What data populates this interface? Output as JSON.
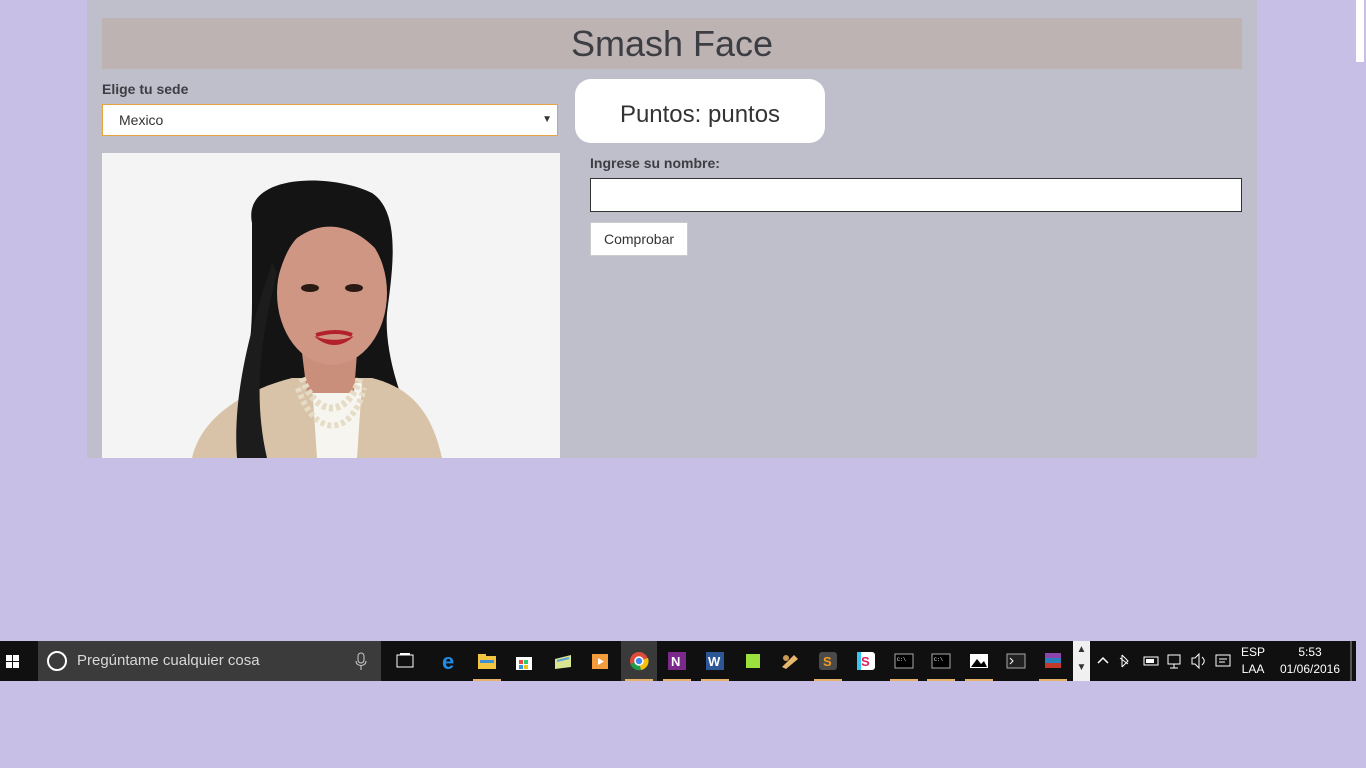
{
  "header": {
    "title": "Smash Face"
  },
  "form": {
    "sede_label": "Elige tu sede",
    "sede_selected": "Mexico",
    "score_text": "Puntos: puntos",
    "name_label": "Ingrese su nombre:",
    "name_value": "",
    "submit_label": "Comprobar"
  },
  "taskbar": {
    "search_placeholder": "Pregúntame cualquier cosa",
    "apps": [
      "task-view",
      "edge",
      "file-explorer",
      "store",
      "folder-sync",
      "media-player",
      "chrome",
      "onenote",
      "word",
      "green-app",
      "paint-tool",
      "sublime-text",
      "slack",
      "cmd",
      "cmd",
      "photos",
      "terminal",
      "winrar"
    ],
    "language_top": "ESP",
    "language_bottom": "LAA",
    "time": "5:53",
    "date": "01/06/2016"
  },
  "colors": {
    "desktop_bg": "#c7bfe6",
    "page_bg": "#bfbfcb",
    "header_bg": "#bcb3b2",
    "select_border": "#e8a33e"
  }
}
